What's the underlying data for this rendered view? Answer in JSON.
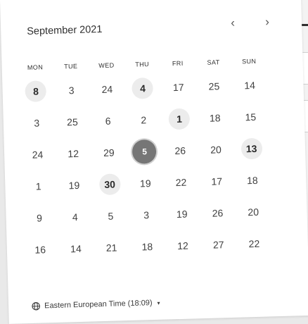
{
  "calendar": {
    "month_label": "September 2021",
    "prev_icon": "‹",
    "next_icon": "›",
    "weekdays": [
      "MON",
      "TUE",
      "WED",
      "THU",
      "FRI",
      "SAT",
      "SUN"
    ],
    "days": [
      {
        "label": "8",
        "state": "available"
      },
      {
        "label": "3",
        "state": "normal"
      },
      {
        "label": "24",
        "state": "normal"
      },
      {
        "label": "4",
        "state": "available"
      },
      {
        "label": "17",
        "state": "normal"
      },
      {
        "label": "25",
        "state": "normal"
      },
      {
        "label": "14",
        "state": "normal"
      },
      {
        "label": "3",
        "state": "normal"
      },
      {
        "label": "25",
        "state": "normal"
      },
      {
        "label": "6",
        "state": "normal"
      },
      {
        "label": "2",
        "state": "normal"
      },
      {
        "label": "1",
        "state": "available"
      },
      {
        "label": "18",
        "state": "normal"
      },
      {
        "label": "15",
        "state": "normal"
      },
      {
        "label": "24",
        "state": "normal"
      },
      {
        "label": "12",
        "state": "normal"
      },
      {
        "label": "29",
        "state": "normal"
      },
      {
        "label": "5",
        "state": "selected"
      },
      {
        "label": "26",
        "state": "normal"
      },
      {
        "label": "20",
        "state": "normal"
      },
      {
        "label": "13",
        "state": "available"
      },
      {
        "label": "1",
        "state": "normal"
      },
      {
        "label": "19",
        "state": "normal"
      },
      {
        "label": "30",
        "state": "available"
      },
      {
        "label": "19",
        "state": "normal"
      },
      {
        "label": "22",
        "state": "normal"
      },
      {
        "label": "17",
        "state": "normal"
      },
      {
        "label": "18",
        "state": "normal"
      },
      {
        "label": "9",
        "state": "normal"
      },
      {
        "label": "4",
        "state": "normal"
      },
      {
        "label": "5",
        "state": "normal"
      },
      {
        "label": "3",
        "state": "normal"
      },
      {
        "label": "19",
        "state": "normal"
      },
      {
        "label": "26",
        "state": "normal"
      },
      {
        "label": "20",
        "state": "normal"
      },
      {
        "label": "16",
        "state": "normal"
      },
      {
        "label": "14",
        "state": "normal"
      },
      {
        "label": "21",
        "state": "normal"
      },
      {
        "label": "18",
        "state": "normal"
      },
      {
        "label": "12",
        "state": "normal"
      },
      {
        "label": "27",
        "state": "normal"
      },
      {
        "label": "22",
        "state": "normal"
      }
    ]
  },
  "timezone": {
    "label": "Eastern European Time (18:09)",
    "icon": "globe-icon",
    "caret": "▾"
  }
}
